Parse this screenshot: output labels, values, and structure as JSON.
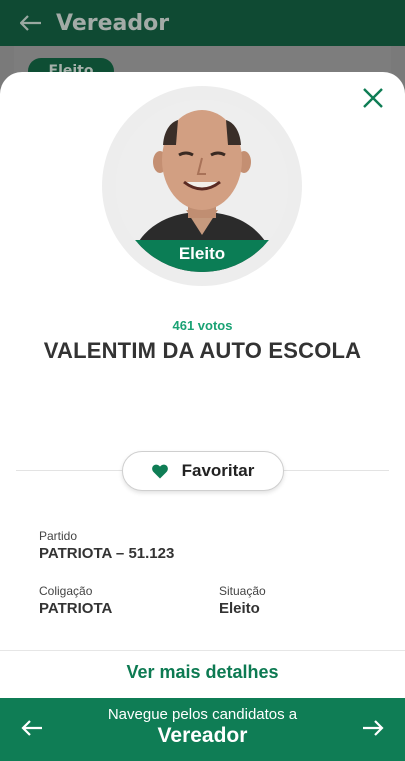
{
  "background": {
    "header_title": "Vereador",
    "chip_label": "Eleito"
  },
  "candidate": {
    "status": "Eleito",
    "votes": "461 votos",
    "name": "VALENTIM DA AUTO ESCOLA"
  },
  "favorite": {
    "label": "Favoritar"
  },
  "info": {
    "partido_label": "Partido",
    "partido_value": "PATRIOTA – 51.123",
    "coligacao_label": "Coligação",
    "coligacao_value": "PATRIOTA",
    "situacao_label": "Situação",
    "situacao_value": "Eleito"
  },
  "details_link": "Ver mais detalhes",
  "footer": {
    "subtitle": "Navegue pelos candidatos a",
    "title": "Vereador"
  },
  "icons": {
    "back": "arrow-left-icon",
    "close": "close-icon",
    "favorite": "heart-icon",
    "prev": "arrow-left-icon",
    "next": "arrow-right-icon"
  },
  "colors": {
    "primary": "#0f7d55",
    "accent": "#1aa274",
    "header_dim": "#0f4a33"
  }
}
